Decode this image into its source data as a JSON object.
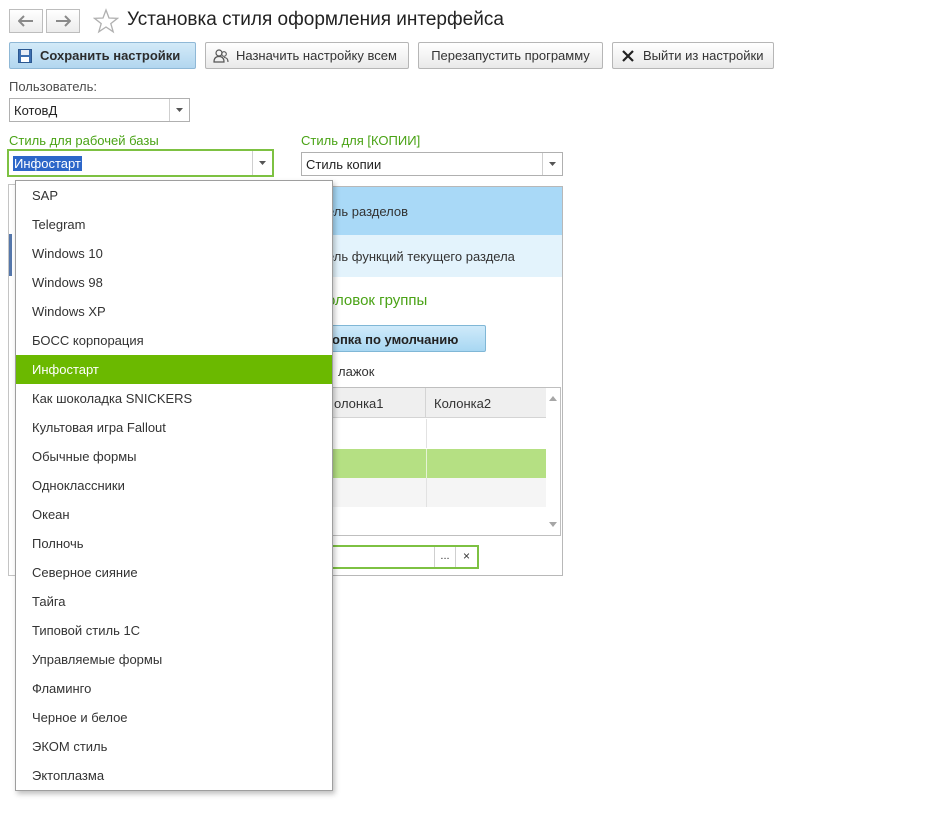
{
  "window": {
    "title": "Установка стиля оформления интерфейса"
  },
  "toolbar": {
    "save_label": "Сохранить настройки",
    "assign_all_label": "Назначить настройку всем",
    "restart_label": "Перезапустить программу",
    "exit_label": "Выйти из настройки"
  },
  "form": {
    "user_label": "Пользователь:",
    "user_value": "КотовД",
    "work_style_label": "Стиль для рабочей базы",
    "work_style_value": "Инфостарт",
    "copy_style_label": "Стиль для [КОПИИ]",
    "copy_style_value": "Стиль копии"
  },
  "preview": {
    "section_panel": "ель разделов",
    "function_panel": "ель функций текущего раздела",
    "group_header": "оловок группы",
    "default_button": "опка по умолчанию",
    "checkbox_label": "лажок",
    "table": {
      "columns": [
        "олонка1",
        "Колонка2"
      ]
    },
    "input_button_dots": "...",
    "input_button_clear": "×"
  },
  "dropdown": {
    "selected": "Инфостарт",
    "options": [
      "SAP",
      "Telegram",
      "Windows 10",
      "Windows 98",
      "Windows XP",
      "БОСС корпорация",
      "Инфостарт",
      "Как шоколадка SNICKERS",
      "Культовая игра Fallout",
      "Обычные формы",
      "Одноклассники",
      "Океан",
      "Полночь",
      "Северное сияние",
      "Тайга",
      "Типовой стиль 1С",
      "Управляемые формы",
      "Фламинго",
      "Черное и белое",
      "ЭКОМ стиль",
      "Эктоплазма"
    ]
  },
  "colors": {
    "accent_green": "#6bb900",
    "label_green": "#4aa316",
    "primary_button": "#b2d6ef",
    "section_panel": "#a9d9f7",
    "highlight_row": "#b5e083"
  },
  "icons": {
    "back": "arrow-left-icon",
    "forward": "arrow-right-icon",
    "favorite": "star-icon",
    "save": "floppy-disk-icon",
    "assign_all": "users-icon",
    "exit": "close-icon"
  }
}
